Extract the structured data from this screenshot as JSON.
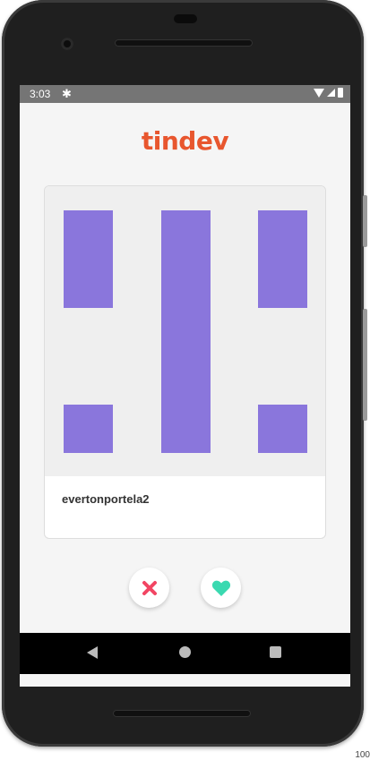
{
  "status_bar": {
    "time": "3:03",
    "settings_icon": "gear-icon",
    "icons": [
      "wifi-icon",
      "signal-icon",
      "battery-icon"
    ]
  },
  "app": {
    "logo": "tindev",
    "logo_color": "#e8562e"
  },
  "card": {
    "username": "evertonportela2",
    "avatar_color": "#8a76dc",
    "avatar_background": "#efefef"
  },
  "actions": {
    "dislike": {
      "icon": "close-icon",
      "color": "#f24563"
    },
    "like": {
      "icon": "heart-icon",
      "color": "#3ad9b0"
    }
  },
  "nav_bar": {
    "icons": [
      "back-icon",
      "home-icon",
      "recent-apps-icon"
    ]
  },
  "footer": {
    "corner_text": "100"
  }
}
